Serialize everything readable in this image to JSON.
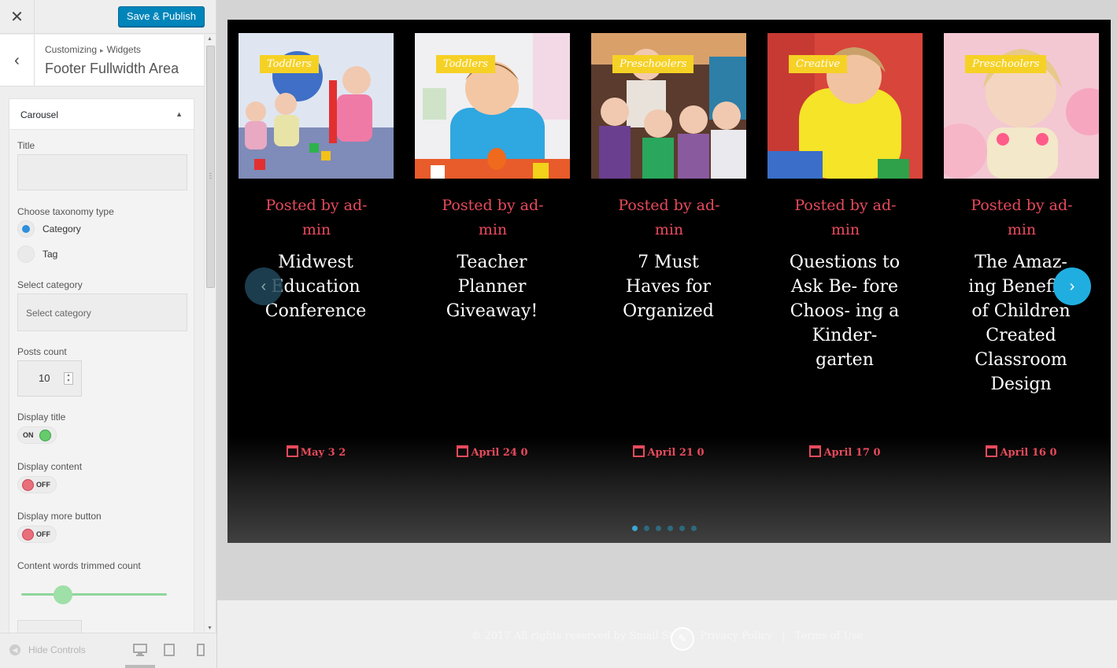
{
  "sidebar": {
    "save_label": "Save & Publish",
    "breadcrumb": [
      "Customizing",
      "Widgets"
    ],
    "section_title": "Footer Fullwidth Area",
    "widget": {
      "title": "Carousel",
      "fields": {
        "title_label": "Title",
        "title_value": "",
        "taxonomy_label": "Choose taxonomy type",
        "taxonomy_options": [
          "Category",
          "Tag"
        ],
        "taxonomy_selected": "Category",
        "category_label": "Select category",
        "category_placeholder": "Select category",
        "posts_count_label": "Posts count",
        "posts_count_value": "10",
        "display_title_label": "Display title",
        "display_title_state": "ON",
        "display_content_label": "Display content",
        "display_content_state": "OFF",
        "display_more_label": "Display more button",
        "display_more_state": "OFF",
        "trim_label": "Content words trimmed count",
        "trim_slider_fraction": 0.3
      }
    },
    "hide_controls_label": "Hide Controls",
    "devices": [
      "desktop-icon",
      "tablet-icon",
      "mobile-icon"
    ]
  },
  "carousel": {
    "posted_by": "Posted by ad- min",
    "cards": [
      {
        "tag": "Toddlers",
        "title": "Midwest Education Conference",
        "date": "May 3 2"
      },
      {
        "tag": "Toddlers",
        "title": "Teacher Planner Giveaway!",
        "date": "April 24 0"
      },
      {
        "tag": "Preschoolers",
        "title": "7 Must Haves for Organized",
        "date": "April 21 0"
      },
      {
        "tag": "Creative",
        "title": "Questions to Ask Be- fore Choos- ing a Kinder- garten",
        "date": "April 17 0"
      },
      {
        "tag": "Preschoolers",
        "title": "The Amaz- ing Benefits of Children Created Classroom Design",
        "date": "April 16 0"
      }
    ],
    "dots_count": 6,
    "active_dot": 0
  },
  "footer": {
    "copyright": "© 2017 All rights reserved by Small St",
    "links": [
      "Privacy Policy",
      "Terms of Use"
    ]
  },
  "colors": {
    "primary": "#0085ba",
    "accent_red": "#e84a5c",
    "tag_yellow": "#f6d125",
    "nav_blue": "#20aee0"
  }
}
